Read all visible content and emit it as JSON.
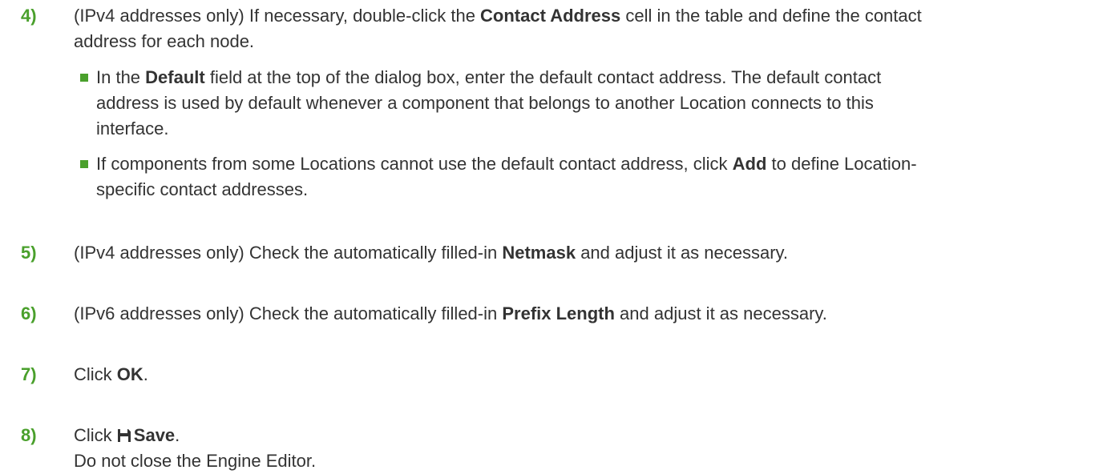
{
  "step4": {
    "number": "4)",
    "pre": "(IPv4 addresses only) If necessary, double-click the ",
    "bold": "Contact Address",
    "post": " cell in the table and define the contact",
    "line2": "address for each node.",
    "bullets": [
      {
        "line1_pre": "In the ",
        "line1_bold": "Default",
        "line1_post": " field at the top of the dialog box, enter the default contact address. The default contact",
        "line2": "address is used by default whenever a component that belongs to another Location connects to this",
        "line3": "interface."
      },
      {
        "line1_pre": "If components from some Locations cannot use the default contact address, click ",
        "line1_bold": "Add",
        "line1_post": " to define Location-",
        "line2": "specific contact addresses."
      }
    ]
  },
  "step5": {
    "number": "5)",
    "pre": "(IPv4 addresses only) Check the automatically filled-in ",
    "bold": "Netmask",
    "post": " and adjust it as necessary."
  },
  "step6": {
    "number": "6)",
    "pre": "(IPv6 addresses only) Check the automatically filled-in ",
    "bold": "Prefix Length",
    "post": " and adjust it as necessary."
  },
  "step7": {
    "number": "7)",
    "pre": "Click ",
    "bold": "OK",
    "post": "."
  },
  "step8": {
    "number": "8)",
    "pre": "Click ",
    "icon": "save-icon",
    "bold": "Save",
    "post": ".",
    "line2": "Do not close the Engine Editor."
  },
  "colors": {
    "accent": "#4aa02c",
    "text": "#333333"
  }
}
